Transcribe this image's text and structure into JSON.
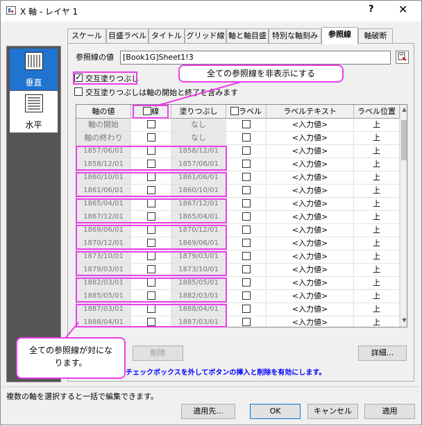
{
  "window": {
    "title": "X 軸 - レイヤ 1",
    "help_label": "?",
    "close_label": "✕"
  },
  "tabs": [
    {
      "label": "スケール"
    },
    {
      "label": "目盛ラベル"
    },
    {
      "label": "タイトル"
    },
    {
      "label": "グリッド線"
    },
    {
      "label": "軸と軸目盛"
    },
    {
      "label": "特別な軸刻み"
    },
    {
      "label": "参照線",
      "active": true
    },
    {
      "label": "軸破断"
    }
  ],
  "sidebar": {
    "items": [
      {
        "label": "垂直",
        "selected": true
      },
      {
        "label": "水平",
        "selected": false
      }
    ]
  },
  "reference": {
    "label": "参照線の値",
    "value": "[Book1G]Sheet1!3"
  },
  "checkboxes": {
    "alternate_fill": {
      "label": "交互塗りつぶし",
      "checked": true
    },
    "alternate_fill_ends": {
      "label": "交互塗りつぶしは軸の開始と終了を含みます",
      "checked": false
    }
  },
  "table": {
    "headers": [
      "軸の値",
      "線",
      "塗りつぶし",
      "ラベル",
      "ラベルテキスト",
      "ラベル位置"
    ],
    "rows": [
      {
        "value": "軸の開始",
        "line": false,
        "fill": "なし",
        "label": false,
        "text": "<入力値>",
        "pos": "上",
        "special": true
      },
      {
        "value": "軸の終わり",
        "line": false,
        "fill": "なし",
        "label": false,
        "text": "<入力値>",
        "pos": "上",
        "special": true
      },
      {
        "value": "1857/06/01",
        "line": false,
        "fill": "1858/12/01",
        "label": false,
        "text": "<入力値>",
        "pos": "上"
      },
      {
        "value": "1858/12/01",
        "line": false,
        "fill": "1857/06/01",
        "label": false,
        "text": "<入力値>",
        "pos": "上"
      },
      {
        "value": "1860/10/01",
        "line": false,
        "fill": "1861/06/01",
        "label": false,
        "text": "<入力値>",
        "pos": "上"
      },
      {
        "value": "1861/06/01",
        "line": false,
        "fill": "1860/10/01",
        "label": false,
        "text": "<入力値>",
        "pos": "上"
      },
      {
        "value": "1865/04/01",
        "line": false,
        "fill": "1867/12/01",
        "label": false,
        "text": "<入力値>",
        "pos": "上"
      },
      {
        "value": "1867/12/01",
        "line": false,
        "fill": "1865/04/01",
        "label": false,
        "text": "<入力値>",
        "pos": "上"
      },
      {
        "value": "1869/06/01",
        "line": false,
        "fill": "1870/12/01",
        "label": false,
        "text": "<入力値>",
        "pos": "上"
      },
      {
        "value": "1870/12/01",
        "line": false,
        "fill": "1869/06/01",
        "label": false,
        "text": "<入力値>",
        "pos": "上"
      },
      {
        "value": "1873/10/01",
        "line": false,
        "fill": "1879/03/01",
        "label": false,
        "text": "<入力値>",
        "pos": "上"
      },
      {
        "value": "1879/03/01",
        "line": false,
        "fill": "1873/10/01",
        "label": false,
        "text": "<入力値>",
        "pos": "上"
      },
      {
        "value": "1882/03/01",
        "line": false,
        "fill": "1885/05/01",
        "label": false,
        "text": "<入力値>",
        "pos": "上"
      },
      {
        "value": "1885/05/01",
        "line": false,
        "fill": "1882/03/01",
        "label": false,
        "text": "<入力値>",
        "pos": "上"
      },
      {
        "value": "1887/03/01",
        "line": false,
        "fill": "1888/04/01",
        "label": false,
        "text": "<入力値>",
        "pos": "上"
      },
      {
        "value": "1888/04/01",
        "line": false,
        "fill": "1887/03/01",
        "label": false,
        "text": "<入力値>",
        "pos": "上"
      }
    ]
  },
  "callouts": {
    "top": "全ての参照線を非表示にする",
    "bottom_line1": "全ての参照線が対にな",
    "bottom_line2": "ります。"
  },
  "buttons": {
    "delete": "削除",
    "details": "詳細...",
    "apply_to": "適用先...",
    "ok": "OK",
    "cancel": "キャンセル",
    "apply": "適用"
  },
  "note": "チェックボックスを外してボタンの挿入と削除を有効にします。",
  "status": "複数の軸を選択すると一括で編集できます。",
  "colors": {
    "highlight": "#ea3fea",
    "selected": "#1f74d1",
    "note": "#0000ff"
  }
}
